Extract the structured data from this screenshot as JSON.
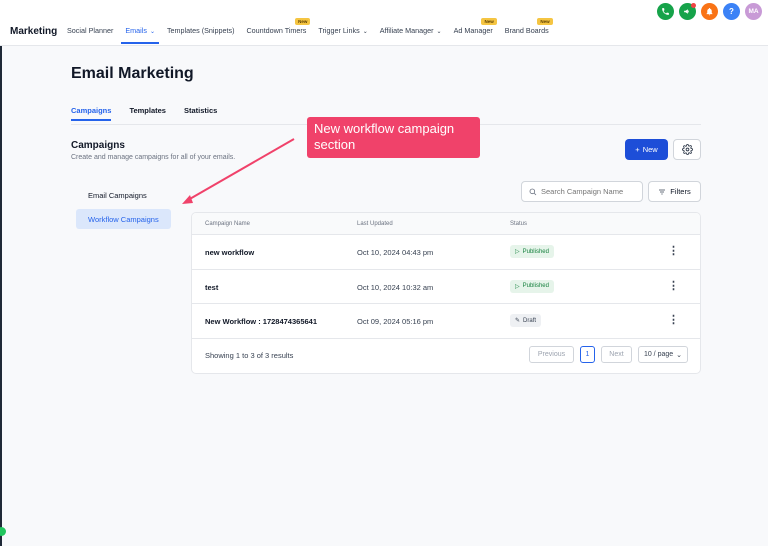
{
  "header": {
    "brand": "Marketing",
    "nav": [
      {
        "label": "Social Planner",
        "chevron": false,
        "badge": ""
      },
      {
        "label": "Emails",
        "chevron": true,
        "badge": "",
        "active": true
      },
      {
        "label": "Templates (Snippets)",
        "chevron": false,
        "badge": ""
      },
      {
        "label": "Countdown Timers",
        "chevron": false,
        "badge": "New"
      },
      {
        "label": "Trigger Links",
        "chevron": true,
        "badge": ""
      },
      {
        "label": "Affiliate Manager",
        "chevron": true,
        "badge": ""
      },
      {
        "label": "Ad Manager",
        "chevron": false,
        "badge": "New"
      },
      {
        "label": "Brand Boards",
        "chevron": false,
        "badge": "New"
      }
    ],
    "icons": [
      "phone-icon",
      "megaphone-icon",
      "bell-icon",
      "help-icon"
    ],
    "avatar_initials": "MA",
    "help_glyph": "?"
  },
  "page": {
    "title": "Email Marketing",
    "tabs": [
      "Campaigns",
      "Templates",
      "Statistics"
    ],
    "section_title": "Campaigns",
    "section_subtitle": "Create and manage campaigns for all of your emails.",
    "new_button": "New",
    "sidebar": [
      "Email Campaigns",
      "Workflow Campaigns"
    ],
    "search_placeholder": "Search Campaign Name",
    "filters_label": "Filters"
  },
  "table": {
    "columns": [
      "Campaign Name",
      "Last Updated",
      "Status"
    ],
    "rows": [
      {
        "name": "new workflow",
        "updated": "Oct 10, 2024 04:43 pm",
        "status": "Published"
      },
      {
        "name": "test",
        "updated": "Oct 10, 2024 10:32 am",
        "status": "Published"
      },
      {
        "name": "New Workflow : 1728474365641",
        "updated": "Oct 09, 2024 05:16 pm",
        "status": "Draft"
      }
    ],
    "showing": "Showing 1 to 3 of 3 results",
    "previous": "Previous",
    "page": "1",
    "next": "Next",
    "per_page": "10 / page"
  },
  "annotation": {
    "callout_text": "New workflow campaign section",
    "color": "#f0426a"
  },
  "colors": {
    "accent": "#2563eb",
    "primary_button": "#1d4ed8"
  }
}
